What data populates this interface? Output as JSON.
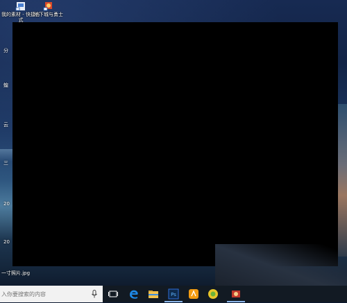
{
  "desktop": {
    "icons": [
      {
        "name": "desktop-shortcut-material",
        "label": "我的素材 - 快捷方式"
      },
      {
        "name": "desktop-shortcut-game",
        "label": "地下城与勇士"
      }
    ],
    "bottom_file_label": "一寸照片.jpg"
  },
  "taskbar": {
    "search_placeholder": "入你要搜索的内容",
    "apps": [
      {
        "name": "task-view-icon",
        "color": "#ffffff"
      },
      {
        "name": "edge-icon",
        "color": "#1e88e5"
      },
      {
        "name": "file-explorer-icon",
        "color": "#f2c14e"
      },
      {
        "name": "photoshop-icon",
        "color": "#2f6ed8"
      },
      {
        "name": "app-orange-icon",
        "color": "#f39c12"
      },
      {
        "name": "app-yellow-circle-icon",
        "color": "#e8c529"
      },
      {
        "name": "game-app-icon",
        "color": "#c0392b"
      }
    ]
  }
}
